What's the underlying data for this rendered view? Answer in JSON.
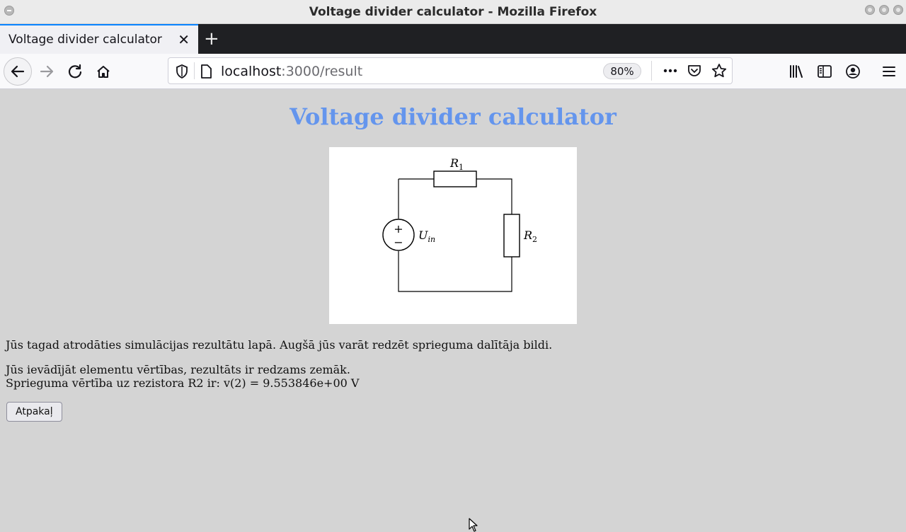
{
  "window": {
    "title": "Voltage divider calculator - Mozilla Firefox"
  },
  "tabs": [
    {
      "label": "Voltage divider calculator"
    }
  ],
  "toolbar": {
    "url_host": "localhost",
    "url_path": ":3000/result",
    "zoom": "80%"
  },
  "page": {
    "title": "Voltage divider calculator",
    "diagram": {
      "r1_label": "R",
      "r1_sub": "1",
      "r2_label": "R",
      "r2_sub": "2",
      "source_label": "U",
      "source_sub": "in",
      "plus": "+",
      "minus": "−"
    },
    "intro": "Jūs tagad atrodāties simulācijas rezultātu lapā. Augšā jūs varāt redzēt sprieguma dalītāja bildi.",
    "info_line1": "Jūs ievādījāt elementu vērtības, rezultāts ir redzams zemāk.",
    "info_line2": "Sprieguma vērtība uz rezistora R2 ir: v(2) = 9.553846e+00 V",
    "back_button": "Atpakaļ"
  },
  "icons": {
    "back": "arrow-left-icon",
    "forward": "arrow-right-icon",
    "reload": "reload-icon",
    "home": "home-icon",
    "shield": "shield-icon",
    "page": "page-icon",
    "more": "more-icon",
    "pocket": "pocket-icon",
    "bookmark": "star-icon",
    "library": "library-icon",
    "sidebar": "sidebar-icon",
    "account": "account-icon",
    "menu": "hamburger-icon"
  }
}
